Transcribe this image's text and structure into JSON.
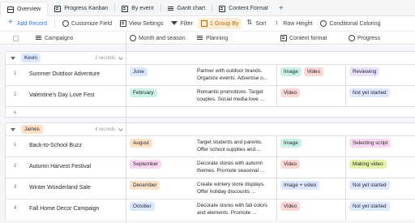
{
  "tabs": [
    {
      "label": "Overview",
      "icon": "grid-icon",
      "active": true
    },
    {
      "label": "Progress Kanban",
      "icon": "kanban-icon"
    },
    {
      "label": "By event",
      "icon": "list-icon"
    },
    {
      "label": "Gantt chart",
      "icon": "gantt-icon"
    },
    {
      "label": "Content Format",
      "icon": "list-icon"
    }
  ],
  "tab_more": "+",
  "toolbar": {
    "add_record": "Add Record",
    "customize_field": "Customize Field",
    "view_settings": "View Settings",
    "filter": "Filter",
    "group_by": "1 Group By",
    "sort": "Sort",
    "row_height": "Row Height",
    "conditional_coloring": "Conditional Coloring"
  },
  "columns": {
    "campaigns": "Campaigns",
    "month": "Month and season",
    "planning": "Planning",
    "content_format": "Content format",
    "progress": "Progress"
  },
  "colors": {
    "accent": "#3370ff",
    "group_by_bg": "#fdecd6",
    "month_tag_blue": "#dbe8ff",
    "month_tag_purple": "#ece2fe",
    "month_tag_orange": "#fde2c8",
    "format_image": "#c9f1e9",
    "format_video": "#fdd7d6",
    "format_image_video": "#dbe8ff",
    "progress_reviewing": "#ece2fe",
    "progress_not_started": "#dbe8ff",
    "progress_selecting": "#fbd9f0",
    "progress_making": "#e4f4a4"
  },
  "groups": [
    {
      "name": "Kevin",
      "name_bg": "#dbe8ff",
      "count": "2 records",
      "rows": [
        {
          "num": "1",
          "campaign": "Summer Outdoor Adventure",
          "month": "June",
          "month_bg": "#dbe8ff",
          "planning": "Partner with outdoor brands. Organize events. Advertise o...",
          "formats": [
            {
              "label": "Image",
              "bg": "#c9f1e9"
            },
            {
              "label": "Video",
              "bg": "#fdd7d6"
            }
          ],
          "progress": "Reviewing",
          "progress_bg": "#ece2fe"
        },
        {
          "num": "2",
          "campaign": "Valentine's Day Love Fest",
          "month": "February",
          "month_bg": "#c9f1e9",
          "planning": "Romantic promotions. Target couples. Social media love ...",
          "formats": [
            {
              "label": "Video",
              "bg": "#fdd7d6"
            }
          ],
          "progress": "Not yet started",
          "progress_bg": "#dbe8ff"
        }
      ]
    },
    {
      "name": "James",
      "name_bg": "#fde2c8",
      "count": "4 records",
      "rows": [
        {
          "num": "1",
          "campaign": "Back-to-School Buzz",
          "month": "August",
          "month_bg": "#fde2c8",
          "planning": "Target students and parents. Offer school supplies and ...",
          "formats": [
            {
              "label": "Image",
              "bg": "#c9f1e9"
            }
          ],
          "progress": "Selecting script",
          "progress_bg": "#fbd9f0"
        },
        {
          "num": "2",
          "campaign": "Autumn Harvest Festival",
          "month": "September",
          "month_bg": "#fbd9f0",
          "planning": "Decorate stores with autumn themes. Promote seasonal ...",
          "formats": [
            {
              "label": "Video",
              "bg": "#fdd7d6"
            }
          ],
          "progress": "Making video",
          "progress_bg": "#e4f4a4"
        },
        {
          "num": "3",
          "campaign": "Winter Wonderland Sale",
          "month": "December",
          "month_bg": "#fde2c8",
          "planning": "Create wintery store displays. Offer holiday discounts ...",
          "formats": [
            {
              "label": "Image + video",
              "bg": "#dbe8ff"
            }
          ],
          "progress": "Not yet started",
          "progress_bg": "#dbe8ff"
        },
        {
          "num": "4",
          "campaign": "Fall Home Decor Campaign",
          "month": "October",
          "month_bg": "#dbe8ff",
          "planning": "Decorate stores with fall colors and elements. Promote ...",
          "formats": [
            {
              "label": "Video",
              "bg": "#fdd7d6"
            }
          ],
          "progress": "Not yet started",
          "progress_bg": "#dbe8ff"
        }
      ]
    }
  ]
}
